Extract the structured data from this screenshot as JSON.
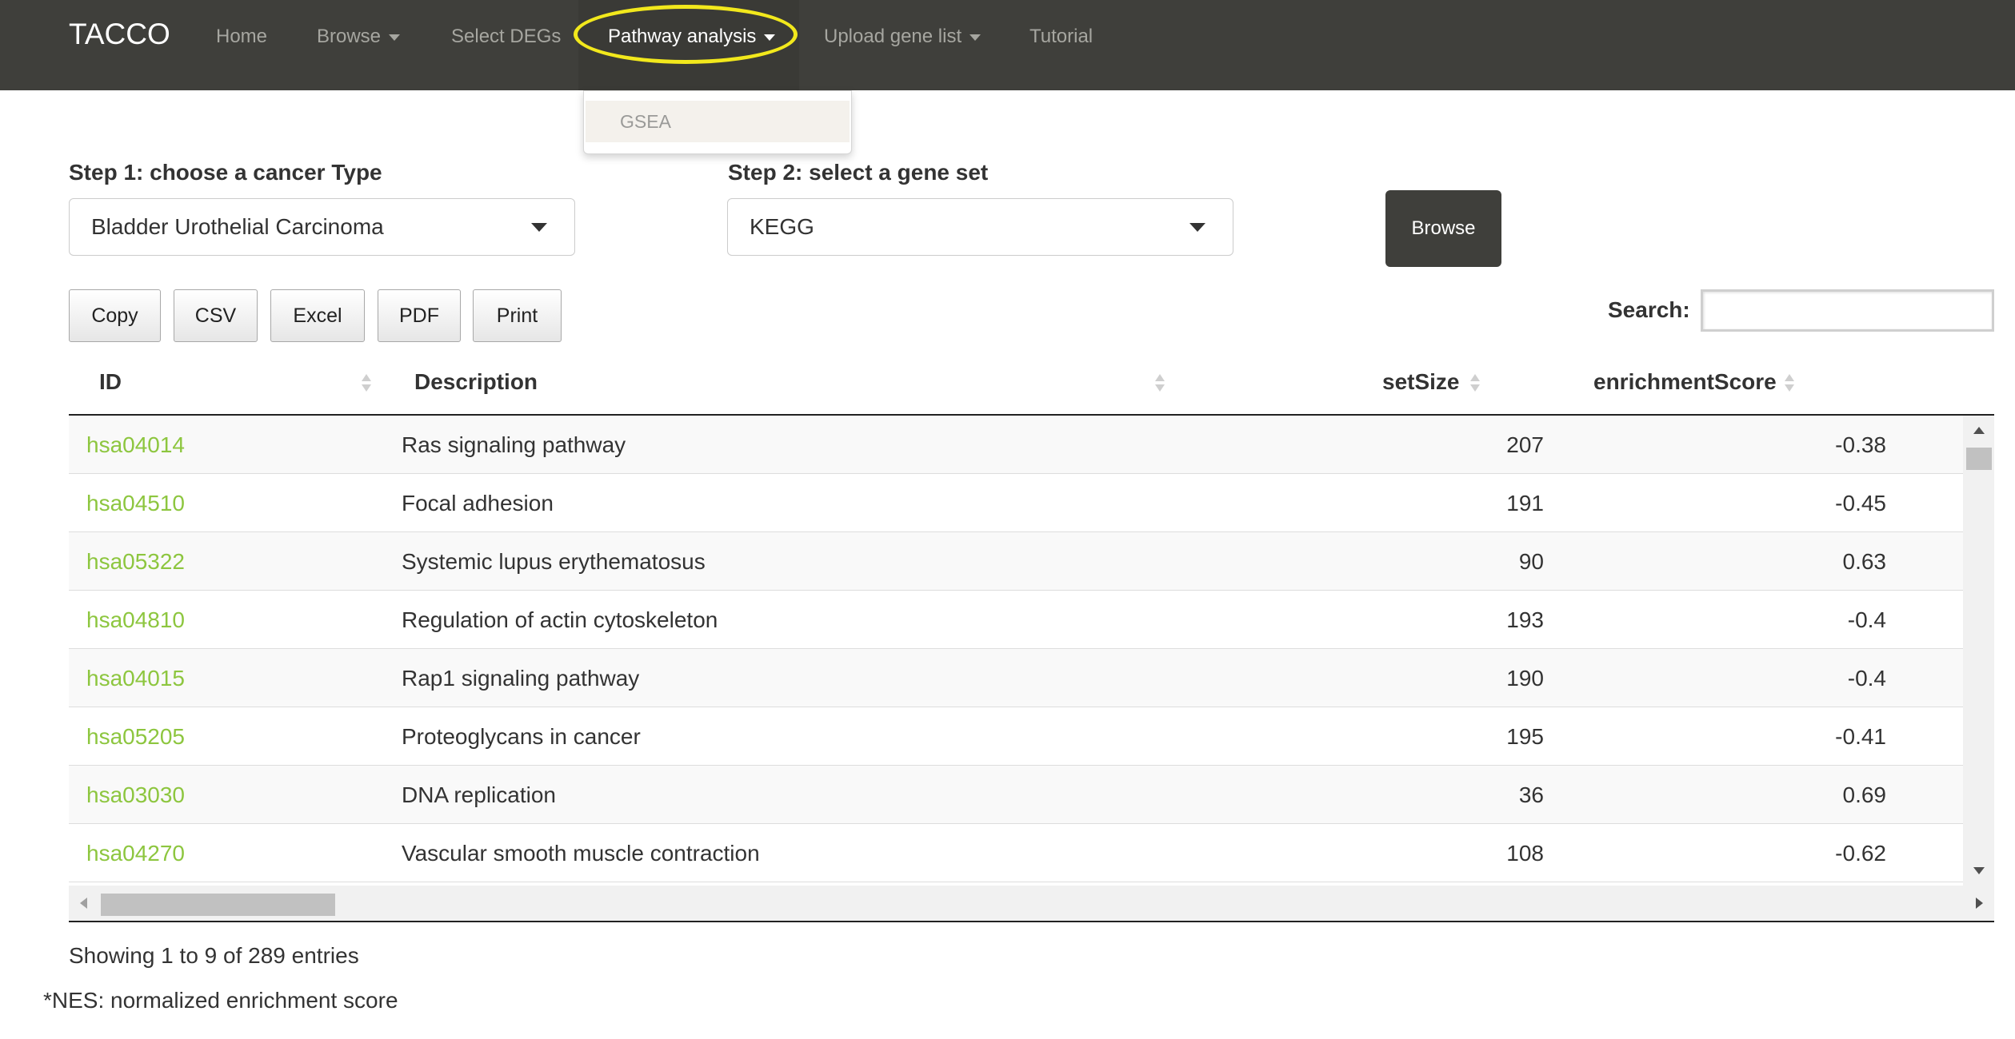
{
  "nav": {
    "brand": "TACCO",
    "items": [
      {
        "label": "Home",
        "caret": false
      },
      {
        "label": "Browse",
        "caret": true
      },
      {
        "label": "Select DEGs",
        "caret": false
      },
      {
        "label": "Pathway analysis",
        "caret": true
      },
      {
        "label": "Upload gene list",
        "caret": true
      },
      {
        "label": "Tutorial",
        "caret": false
      }
    ],
    "dropdown": {
      "items": [
        "GSEA"
      ]
    }
  },
  "form": {
    "step1_label": "Step 1: choose a cancer Type",
    "step1_value": "Bladder Urothelial Carcinoma",
    "step2_label": "Step 2: select a gene set",
    "step2_value": "KEGG",
    "browse_label": "Browse"
  },
  "export_buttons": [
    "Copy",
    "CSV",
    "Excel",
    "PDF",
    "Print"
  ],
  "search": {
    "label": "Search:",
    "value": ""
  },
  "table": {
    "columns": [
      "ID",
      "Description",
      "setSize",
      "enrichmentScore"
    ],
    "rows": [
      {
        "id": "hsa04014",
        "description": "Ras signaling pathway",
        "setSize": "207",
        "enrichmentScore": "-0.38"
      },
      {
        "id": "hsa04510",
        "description": "Focal adhesion",
        "setSize": "191",
        "enrichmentScore": "-0.45"
      },
      {
        "id": "hsa05322",
        "description": "Systemic lupus erythematosus",
        "setSize": "90",
        "enrichmentScore": "0.63"
      },
      {
        "id": "hsa04810",
        "description": "Regulation of actin cytoskeleton",
        "setSize": "193",
        "enrichmentScore": "-0.4"
      },
      {
        "id": "hsa04015",
        "description": "Rap1 signaling pathway",
        "setSize": "190",
        "enrichmentScore": "-0.4"
      },
      {
        "id": "hsa05205",
        "description": "Proteoglycans in cancer",
        "setSize": "195",
        "enrichmentScore": "-0.41"
      },
      {
        "id": "hsa03030",
        "description": "DNA replication",
        "setSize": "36",
        "enrichmentScore": "0.69"
      },
      {
        "id": "hsa04270",
        "description": "Vascular smooth muscle contraction",
        "setSize": "108",
        "enrichmentScore": "-0.62"
      }
    ],
    "info": "Showing 1 to 9 of 289 entries"
  },
  "note": "*NES: normalized enrichment score",
  "colors": {
    "navbar": "#3f3f3b",
    "link_green": "#8dc63f",
    "highlight_ring": "#f2e81c"
  }
}
